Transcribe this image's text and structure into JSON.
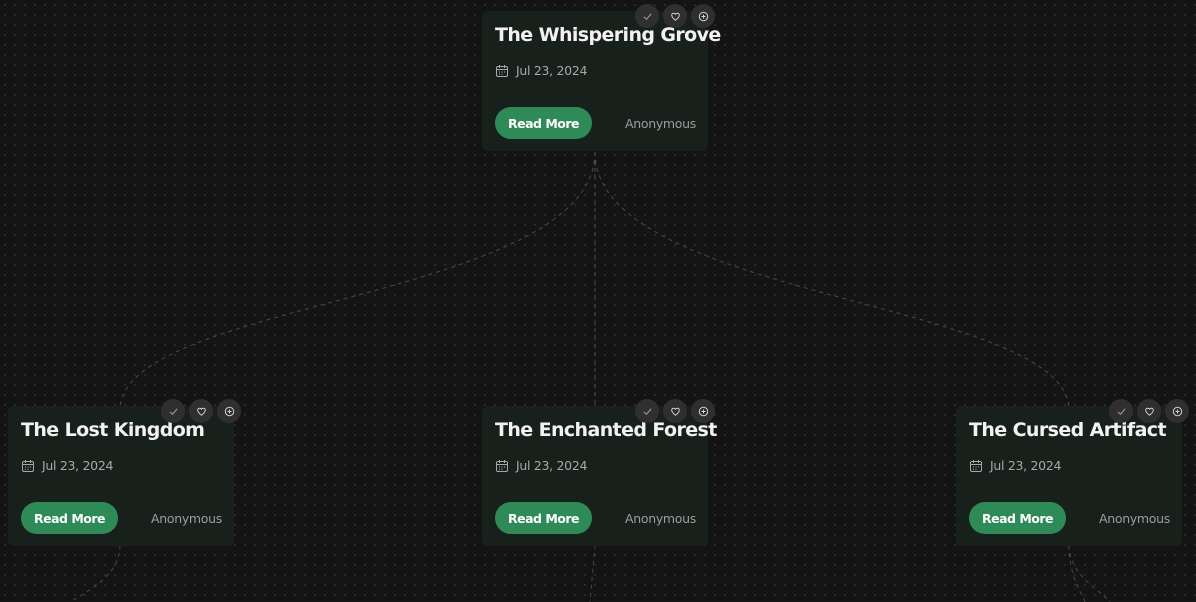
{
  "cards": [
    {
      "title": "The Whispering Grove",
      "date": "Jul 23, 2024",
      "button_label": "Read More",
      "author": "Anonymous"
    },
    {
      "title": "The Lost Kingdom",
      "date": "Jul 23, 2024",
      "button_label": "Read More",
      "author": "Anonymous"
    },
    {
      "title": "The Enchanted Forest",
      "date": "Jul 23, 2024",
      "button_label": "Read More",
      "author": "Anonymous"
    },
    {
      "title": "The Cursed Artifact",
      "date": "Jul 23, 2024",
      "button_label": "Read More",
      "author": "Anonymous"
    }
  ],
  "card_actions": [
    "check-icon",
    "heart-icon",
    "add-circle-icon"
  ],
  "icons": {
    "date": "calendar-icon"
  },
  "colors": {
    "background": "#141414",
    "card_background": "#18201c",
    "accent_button": "#2e8b57",
    "edge": "#4a4a4a"
  }
}
